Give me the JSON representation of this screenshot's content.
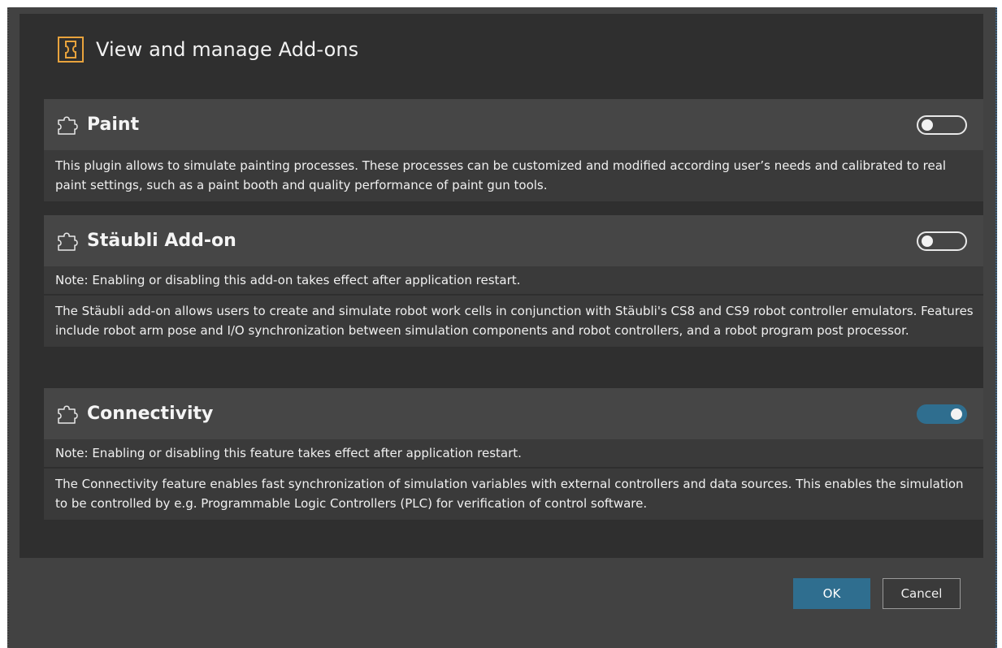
{
  "dialog": {
    "title": "View and manage Add-ons",
    "header_icon": "puzzle-icon"
  },
  "addons": [
    {
      "name": "Paint",
      "enabled": false,
      "note": "",
      "description": "This plugin allows to simulate painting processes. These processes can be customized and modified according user’s needs and calibrated to real paint settings, such as a paint booth and quality performance of paint gun tools."
    },
    {
      "name": "Stäubli Add-on",
      "enabled": false,
      "note": "Note: Enabling or disabling this add-on takes effect after application restart.",
      "description": "The Stäubli add-on allows users to create and simulate robot work cells in conjunction with Stäubli's CS8 and CS9 robot controller emulators. Features include robot arm pose and I/O synchronization between simulation components and robot controllers, and a robot program post processor."
    },
    {
      "name": "Connectivity",
      "enabled": true,
      "note": "Note: Enabling or disabling this feature takes effect after application restart.",
      "description": "The Connectivity feature enables fast synchronization of simulation variables with external controllers and data sources. This enables the simulation to be controlled by e.g. Programmable Logic Controllers (PLC) for verification of control software."
    }
  ],
  "footer": {
    "ok_label": "OK",
    "cancel_label": "Cancel"
  },
  "colors": {
    "accent": "#2f6e8f",
    "header_icon": "#e8a33d",
    "background": "#2f2f2f"
  }
}
